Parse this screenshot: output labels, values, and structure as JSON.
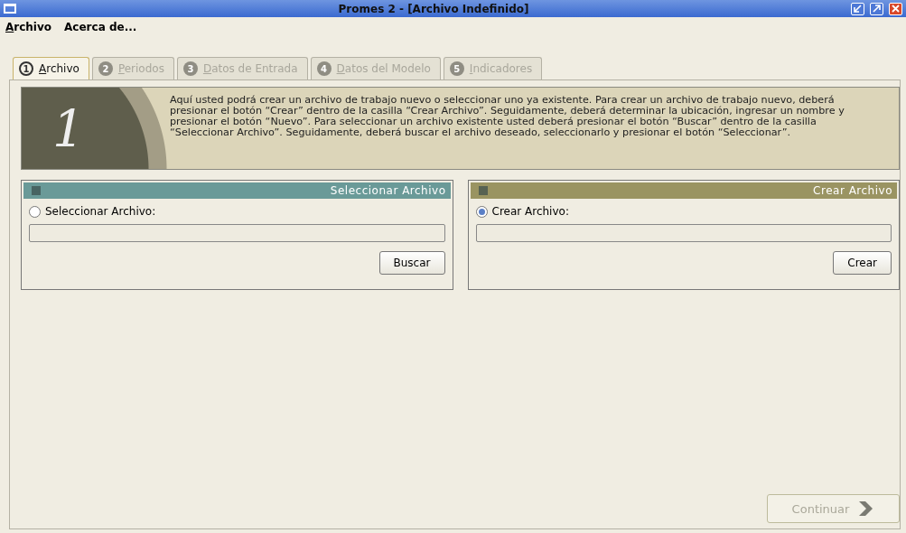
{
  "window": {
    "title": "Promes 2 - [Archivo Indefinido]"
  },
  "menu": [
    "Archivo",
    "Acerca de..."
  ],
  "tabs": [
    {
      "number": "1",
      "label": "Archivo",
      "selected": true,
      "disabled": false
    },
    {
      "number": "2",
      "label": "Periodos",
      "selected": false,
      "disabled": true
    },
    {
      "number": "3",
      "label": "Datos de Entrada",
      "selected": false,
      "disabled": true
    },
    {
      "number": "4",
      "label": "Datos del Modelo",
      "selected": false,
      "disabled": true
    },
    {
      "number": "5",
      "label": "Indicadores",
      "selected": false,
      "disabled": true
    }
  ],
  "banner": {
    "step": "1",
    "text": "Aquí usted podrá crear un archivo de trabajo nuevo o seleccionar uno ya existente. Para crear un archivo de trabajo nuevo, deberá presionar el botón “Crear” dentro de la casilla “Crear Archivo”. Seguidamente, deberá determinar la ubicación, ingresar un nombre y presionar el botón “Nuevo”. Para seleccionar un archivo existente usted deberá presionar el botón “Buscar” dentro de la casilla “Seleccionar Archivo”. Seguidamente, deberá buscar el archivo deseado, seleccionarlo y presionar el botón “Seleccionar”."
  },
  "panels": [
    {
      "title": "Seleccionar Archivo",
      "color": "#6a9a98",
      "option": "Seleccionar Archivo:",
      "selected": false,
      "button": "Buscar"
    },
    {
      "title": "Crear Archivo",
      "color": "#9a9462",
      "option": "Crear Archivo:",
      "selected": true,
      "button": "Crear"
    }
  ],
  "continue_button": {
    "label": "Continuar",
    "disabled": true
  }
}
